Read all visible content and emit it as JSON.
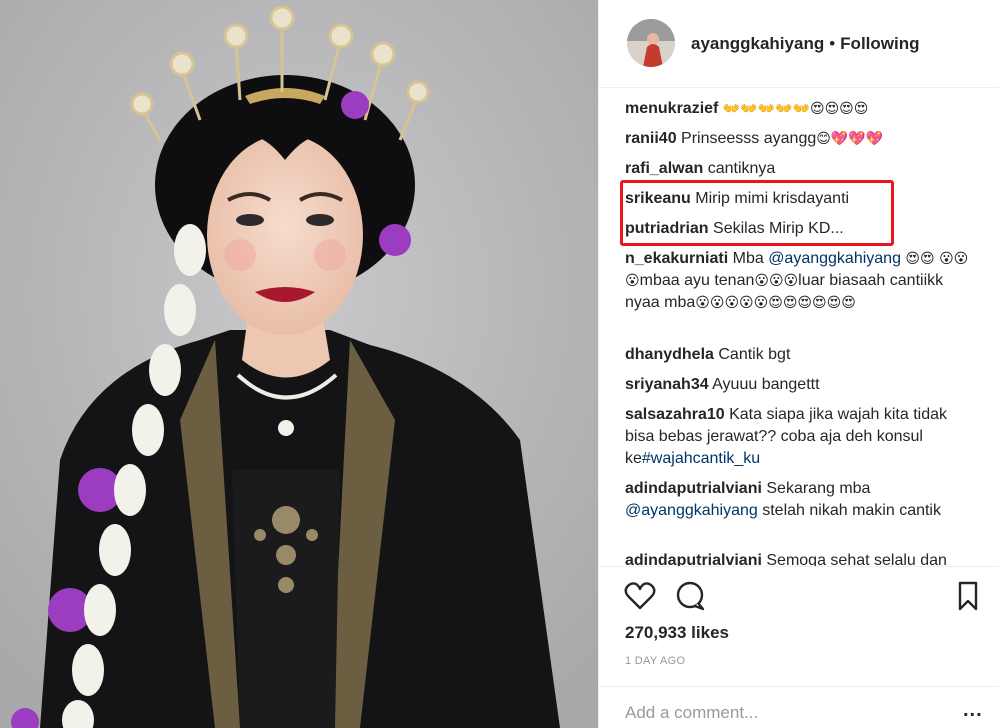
{
  "post": {
    "username": "ayanggkahiyang",
    "separator": "•",
    "follow_status": "Following"
  },
  "comments": [
    {
      "user": "menukrazief",
      "parts": [
        {
          "t": "emoji",
          "v": "👐👐👐👐👐😍😍😍😍"
        }
      ]
    },
    {
      "user": "ranii40",
      "parts": [
        {
          "t": "text",
          "v": "Prinseesss ayangg"
        },
        {
          "t": "emoji",
          "v": "😊💖💖💖"
        }
      ]
    },
    {
      "user": "rafi_alwan",
      "parts": [
        {
          "t": "text",
          "v": "cantiknya"
        }
      ]
    },
    {
      "user": "srikeanu",
      "parts": [
        {
          "t": "text",
          "v": "Mirip mimi krisdayanti"
        }
      ]
    },
    {
      "user": "putriadrian",
      "parts": [
        {
          "t": "text",
          "v": "Sekilas Mirip KD..."
        }
      ]
    },
    {
      "user": "n_ekakurniati",
      "parts": [
        {
          "t": "text",
          "v": "Mba "
        },
        {
          "t": "mention",
          "v": "@ayanggkahiyang"
        },
        {
          "t": "emoji",
          "v": " 😍😍"
        },
        {
          "t": "emoji",
          "v": "😮😮😮"
        },
        {
          "t": "text",
          "v": "mbaa ayu tenan"
        },
        {
          "t": "emoji",
          "v": "😮😮😮"
        },
        {
          "t": "text",
          "v": "luar biasaah cantiikk nyaa mba"
        },
        {
          "t": "emoji",
          "v": "😮😮😮😮😮😍😍😍😍😍😍"
        }
      ]
    },
    {
      "user": "dhanydhela",
      "parts": [
        {
          "t": "text",
          "v": "Cantik bgt"
        }
      ]
    },
    {
      "user": "sriyanah34",
      "parts": [
        {
          "t": "text",
          "v": "Ayuuu bangettt"
        }
      ]
    },
    {
      "user": "salsazahra10",
      "parts": [
        {
          "t": "text",
          "v": "Kata siapa jika wajah kita tidak bisa bebas jerawat?? coba aja deh konsul ke"
        },
        {
          "t": "mention",
          "v": "#wajahcantik_ku"
        }
      ]
    },
    {
      "user": "adindaputrialviani",
      "parts": [
        {
          "t": "text",
          "v": "Sekarang mba "
        },
        {
          "t": "mention",
          "v": "@ayanggkahiyang"
        },
        {
          "t": "text",
          "v": " stelah nikah makin cantik"
        }
      ]
    },
    {
      "user": "adindaputrialviani",
      "parts": [
        {
          "t": "text",
          "v": "Semoga sehat selalu dan"
        }
      ]
    }
  ],
  "actions": {
    "like_icon": "heart-outline-icon",
    "comment_icon": "speech-bubble-icon",
    "save_icon": "bookmark-icon"
  },
  "likes_text": "270,933 likes",
  "time_text": "1 DAY AGO",
  "add_comment": {
    "placeholder": "Add a comment...",
    "more_label": "..."
  },
  "colors": {
    "highlight": "#e8161d",
    "mention": "#003569",
    "muted": "#999999",
    "text": "#262626"
  }
}
